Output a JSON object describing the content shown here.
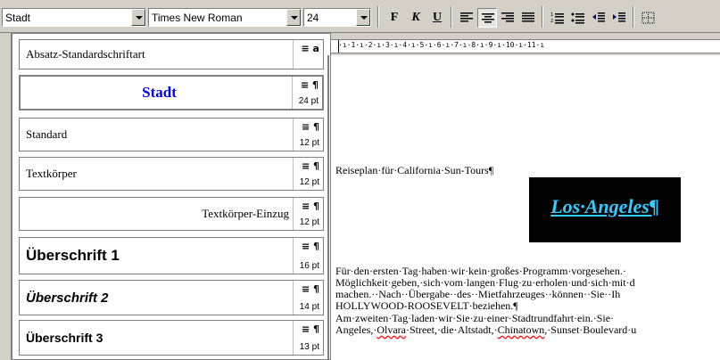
{
  "toolbar": {
    "style_value": "Stadt",
    "font_value": "Times New Roman",
    "size_value": "24",
    "bold_label": "F",
    "italic_label": "K",
    "underline_label": "U"
  },
  "style_list": {
    "items": [
      {
        "name": "Absatz-Standardschriftart",
        "glyph": "≡ a",
        "pt": ""
      },
      {
        "name": "Stadt",
        "glyph": "≡ ¶",
        "pt": "24 pt"
      },
      {
        "name": "Standard",
        "glyph": "≡ ¶",
        "pt": "12 pt"
      },
      {
        "name": "Textkörper",
        "glyph": "≡ ¶",
        "pt": "12 pt"
      },
      {
        "name": "Textkörper-Einzug",
        "glyph": "≡ ¶",
        "pt": "12 pt"
      },
      {
        "name": "Überschrift 1",
        "glyph": "≡ ¶",
        "pt": "16 pt"
      },
      {
        "name": "Überschrift 2",
        "glyph": "≡ ¶",
        "pt": "14 pt"
      },
      {
        "name": "Überschrift 3",
        "glyph": "≡ ¶",
        "pt": "13 pt"
      }
    ]
  },
  "ruler": {
    "marks": "·ı·1·ı·2·ı·3·ı·4·ı·5·ı·6·ı·7·ı·8·ı·9·ı·10·ı·11·ı"
  },
  "document": {
    "line1": "Reiseplan·für·California·Sun-Tours¶",
    "heading": "Los·Angeles¶",
    "para1_l1": "Für·den·ersten·Tag·haben·wir·kein·großes·Programm·vorgesehen.·",
    "para1_l2": "Möglichkeit·geben,·sich·vom·langen·Flug·zu·erholen·und·sich·mit·d",
    "para1_l3": "machen.··Nach··Übergabe··des··Mietfahrzeuges··können··Sie··Ih",
    "para1_l4": "HOLLYWOOD-ROOSEVELT·beziehen.¶",
    "para2_l1": "Am·zweiten·Tag·laden·wir·Sie·zu·einer·Stadtrundfahrt·ein.·Sie·",
    "para2_l2a": "Angeles,·",
    "para2_l2b": "Olvara",
    "para2_l2c": "·Street,·die·Altstadt,·",
    "para2_l2d": "Chinatown",
    "para2_l2e": ",·Sunset·Boulevard·u"
  }
}
